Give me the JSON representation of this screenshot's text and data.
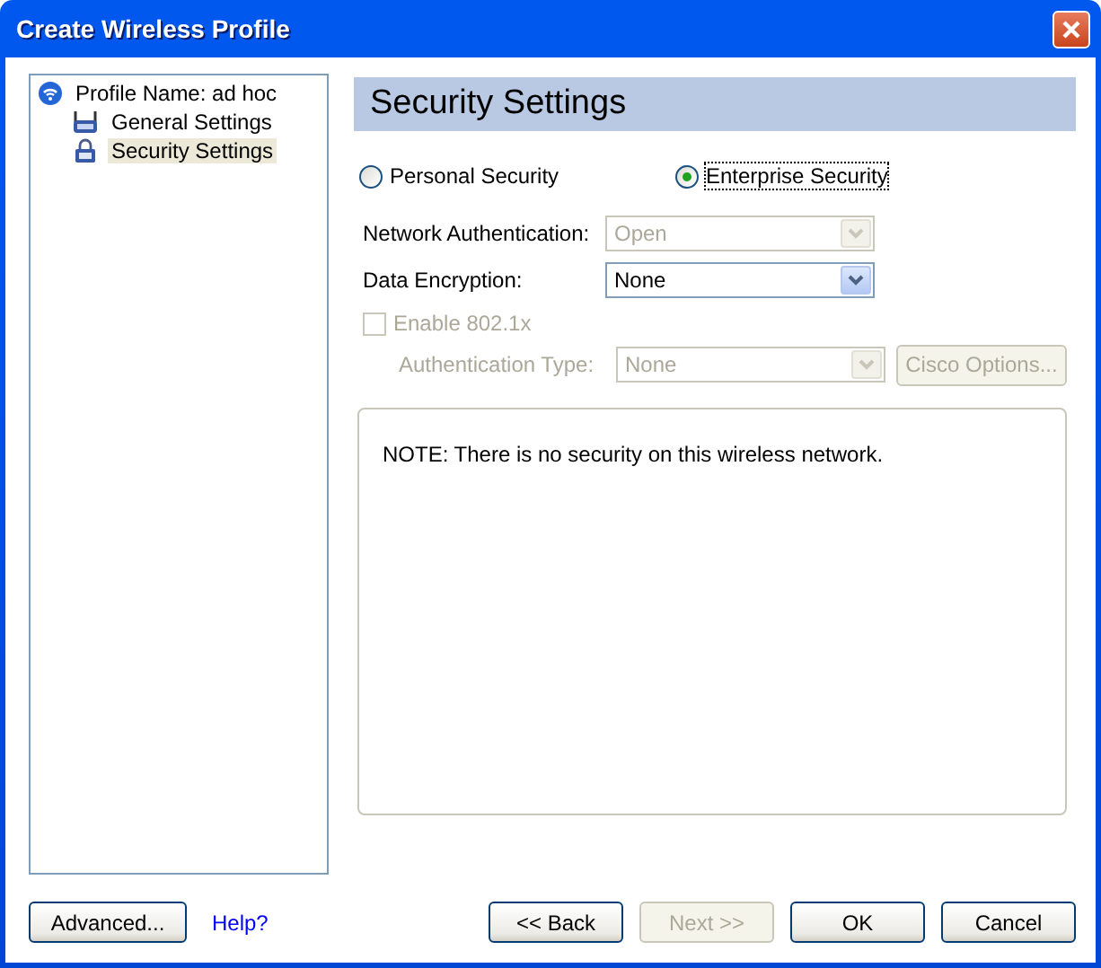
{
  "window": {
    "title": "Create Wireless Profile"
  },
  "tree": {
    "label": "Profile Name: ad hoc",
    "children": [
      {
        "label": "General Settings",
        "kind": "general",
        "selected": false
      },
      {
        "label": "Security Settings",
        "kind": "security",
        "selected": true
      }
    ]
  },
  "header": "Security Settings",
  "security_modes": [
    {
      "label": "Personal Security",
      "selected": false
    },
    {
      "label": "Enterprise Security",
      "selected": true
    }
  ],
  "fields": [
    {
      "label": "Network Authentication:",
      "value": "Open",
      "disabled": true
    },
    {
      "label": "Data Encryption:",
      "value": "None",
      "disabled": false
    }
  ],
  "enable_8021x": {
    "label": "Enable 802.1x",
    "checked": false,
    "disabled": true
  },
  "auth_type": {
    "label": "Authentication Type:",
    "value": "None",
    "disabled": true
  },
  "cisco_options": {
    "label": "Cisco Options...",
    "disabled": true
  },
  "note": "NOTE: There is no security on this wireless network.",
  "footer": {
    "advanced": "Advanced...",
    "help": "Help?",
    "buttons": [
      {
        "label": "<< Back",
        "disabled": false
      },
      {
        "label": "Next >>",
        "disabled": true
      },
      {
        "label": "OK",
        "disabled": false
      },
      {
        "label": "Cancel",
        "disabled": false
      }
    ]
  }
}
